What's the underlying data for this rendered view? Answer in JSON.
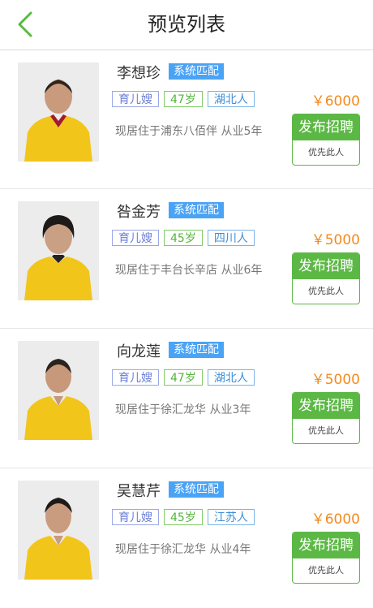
{
  "header": {
    "title": "预览列表"
  },
  "candidates": [
    {
      "name": "李想珍",
      "match": "系统匹配",
      "job": "育儿嫂",
      "age": "47岁",
      "region": "湖北人",
      "desc": "现居住于浦东八佰伴 从业5年",
      "price": "￥6000",
      "publish": "发布招聘",
      "prefer": "优先此人"
    },
    {
      "name": "咎金芳",
      "match": "系统匹配",
      "job": "育儿嫂",
      "age": "45岁",
      "region": "四川人",
      "desc": "现居住于丰台长辛店 从业6年",
      "price": "￥5000",
      "publish": "发布招聘",
      "prefer": "优先此人"
    },
    {
      "name": "向龙莲",
      "match": "系统匹配",
      "job": "育儿嫂",
      "age": "47岁",
      "region": "湖北人",
      "desc": "现居住于徐汇龙华 从业3年",
      "price": "￥5000",
      "publish": "发布招聘",
      "prefer": "优先此人"
    },
    {
      "name": "吴慧芹",
      "match": "系统匹配",
      "job": "育儿嫂",
      "age": "45岁",
      "region": "江苏人",
      "desc": "现居住于徐汇龙华 从业4年",
      "price": "￥6000",
      "publish": "发布招聘",
      "prefer": "优先此人"
    }
  ],
  "colors": {
    "accent_green": "#5cb845",
    "match_blue": "#4aa3f5",
    "price_orange": "#f28a1d"
  }
}
